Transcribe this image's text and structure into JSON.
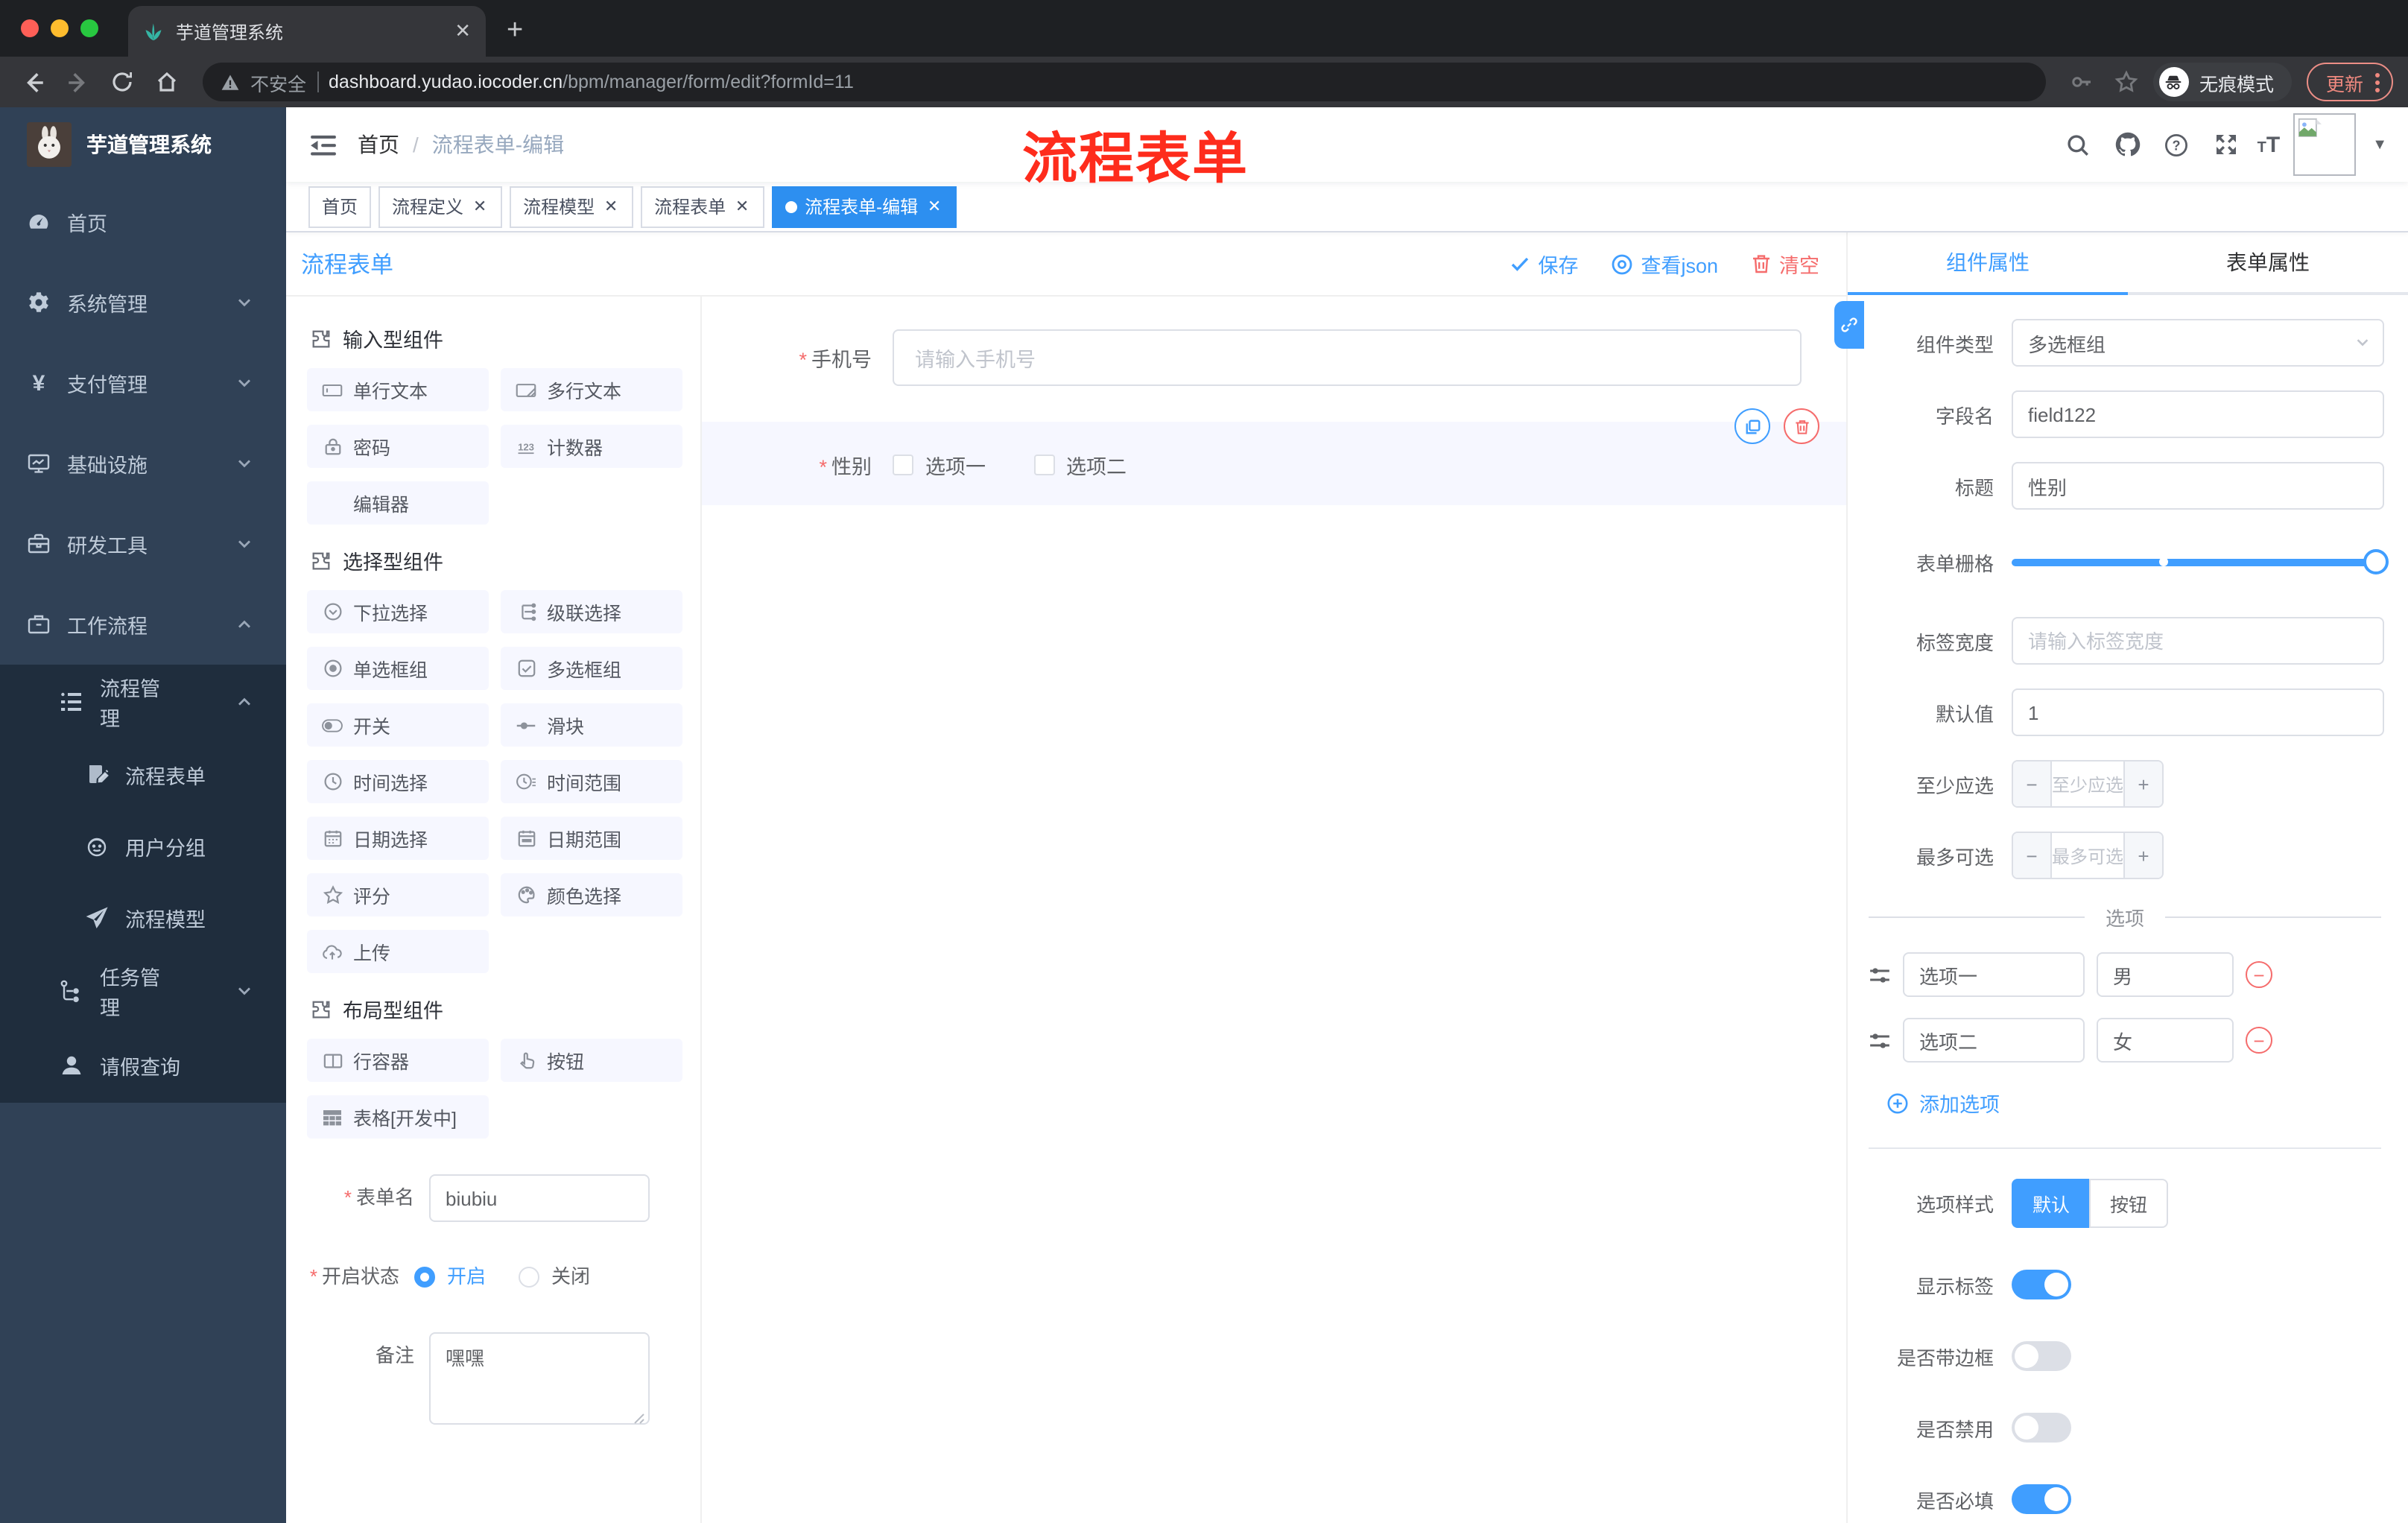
{
  "colors": {
    "accent": "#409eff",
    "danger": "#f56c6c",
    "tag_active": "#2d8ff0",
    "sidebar_bg": "#304156",
    "submenu_bg": "#1f2d3d",
    "chip_bg": "#f6f7ff"
  },
  "browser": {
    "tab_title": "芋道管理系统",
    "security_label": "不安全",
    "url_host": "dashboard.yudao.iocoder.cn",
    "url_path": "/bpm/manager/form/edit?formId=11",
    "incognito_label": "无痕模式",
    "update_label": "更新"
  },
  "annotation": {
    "text": "流程表单"
  },
  "sidebar": {
    "logo_title": "芋道管理系统",
    "items": [
      {
        "key": "home",
        "icon": "dashboard",
        "label": "首页",
        "arrow": ""
      },
      {
        "key": "system",
        "icon": "gear",
        "label": "系统管理",
        "arrow": "down"
      },
      {
        "key": "payment",
        "icon": "yen",
        "label": "支付管理",
        "arrow": "down"
      },
      {
        "key": "infra",
        "icon": "monitor",
        "label": "基础设施",
        "arrow": "down"
      },
      {
        "key": "devtools",
        "icon": "toolbox",
        "label": "研发工具",
        "arrow": "down"
      },
      {
        "key": "workflow",
        "icon": "briefcase",
        "label": "工作流程",
        "arrow": "up"
      }
    ],
    "submenu": [
      {
        "key": "process-mgmt",
        "icon": "listtree",
        "label": "流程管理",
        "arrow": "up",
        "level": 1
      },
      {
        "key": "process-form",
        "icon": "docedit",
        "label": "流程表单",
        "arrow": "",
        "level": 2
      },
      {
        "key": "user-group",
        "icon": "face",
        "label": "用户分组",
        "arrow": "",
        "level": 2
      },
      {
        "key": "process-model",
        "icon": "send",
        "label": "流程模型",
        "arrow": "",
        "level": 2
      },
      {
        "key": "task-mgmt",
        "icon": "tree",
        "label": "任务管理",
        "arrow": "down",
        "level": 1
      },
      {
        "key": "leave-query",
        "icon": "person",
        "label": "请假查询",
        "arrow": "",
        "level": 1
      }
    ]
  },
  "navbar": {
    "breadcrumb_home": "首页",
    "breadcrumb_sep": "/",
    "breadcrumb_current": "流程表单-编辑"
  },
  "tags": [
    {
      "key": "home",
      "label": "首页",
      "closable": false,
      "active": false
    },
    {
      "key": "process-def",
      "label": "流程定义",
      "closable": true,
      "active": false
    },
    {
      "key": "process-model",
      "label": "流程模型",
      "closable": true,
      "active": false
    },
    {
      "key": "process-form",
      "label": "流程表单",
      "closable": true,
      "active": false
    },
    {
      "key": "process-form-edit",
      "label": "流程表单-编辑",
      "closable": true,
      "active": true
    }
  ],
  "editor": {
    "title": "流程表单",
    "actions": {
      "save": "保存",
      "view_json": "查看json",
      "clear": "清空"
    },
    "palette": {
      "sections": [
        {
          "title": "输入型组件",
          "items": [
            {
              "icon": "input",
              "label": "单行文本"
            },
            {
              "icon": "textarea",
              "label": "多行文本"
            },
            {
              "icon": "lock",
              "label": "密码"
            },
            {
              "icon": "counter",
              "label": "计数器"
            },
            {
              "icon": "none",
              "label": "编辑器"
            }
          ]
        },
        {
          "title": "选择型组件",
          "items": [
            {
              "icon": "select",
              "label": "下拉选择"
            },
            {
              "icon": "cascader",
              "label": "级联选择"
            },
            {
              "icon": "radio",
              "label": "单选框组"
            },
            {
              "icon": "checkbox",
              "label": "多选框组"
            },
            {
              "icon": "switch",
              "label": "开关"
            },
            {
              "icon": "slideri",
              "label": "滑块"
            },
            {
              "icon": "time",
              "label": "时间选择"
            },
            {
              "icon": "timerange",
              "label": "时间范围"
            },
            {
              "icon": "date",
              "label": "日期选择"
            },
            {
              "icon": "daterange",
              "label": "日期范围"
            },
            {
              "icon": "star",
              "label": "评分"
            },
            {
              "icon": "palettei",
              "label": "颜色选择"
            },
            {
              "icon": "upload",
              "label": "上传"
            }
          ]
        },
        {
          "title": "布局型组件",
          "items": [
            {
              "icon": "rowc",
              "label": "行容器"
            },
            {
              "icon": "hand",
              "label": "按钮"
            },
            {
              "icon": "tablei",
              "label": "表格[开发中]"
            }
          ]
        }
      ]
    },
    "meta": {
      "name_label": "表单名",
      "name_value": "biubiu",
      "status_label": "开启状态",
      "status_on": "开启",
      "status_off": "关闭",
      "remark_label": "备注",
      "remark_value": "嘿嘿"
    },
    "canvas": {
      "phone": {
        "label": "手机号",
        "placeholder": "请输入手机号"
      },
      "gender": {
        "label": "性别",
        "options": [
          "选项一",
          "选项二"
        ]
      }
    }
  },
  "props": {
    "tabs": {
      "component": "组件属性",
      "form": "表单属性"
    },
    "rows": {
      "type_label": "组件类型",
      "type_value": "多选框组",
      "field_label": "字段名",
      "field_value": "field122",
      "title_label": "标题",
      "title_value": "性别",
      "grid_label": "表单栅格",
      "labelw_label": "标签宽度",
      "labelw_placeholder": "请输入标签宽度",
      "default_label": "默认值",
      "default_value": "1",
      "min_label": "至少应选",
      "min_placeholder": "至少应选",
      "max_label": "最多可选",
      "max_placeholder": "最多可选"
    },
    "options_title": "选项",
    "options": [
      {
        "label": "选项一",
        "value": "男"
      },
      {
        "label": "选项二",
        "value": "女"
      }
    ],
    "add_option_label": "添加选项",
    "style_label": "选项样式",
    "style_choices": [
      {
        "label": "默认",
        "on": true
      },
      {
        "label": "按钮",
        "on": false
      }
    ],
    "switches": [
      {
        "key": "show-label",
        "label": "显示标签",
        "on": true
      },
      {
        "key": "bordered",
        "label": "是否带边框",
        "on": false
      },
      {
        "key": "disabled",
        "label": "是否禁用",
        "on": false
      },
      {
        "key": "required",
        "label": "是否必填",
        "on": true
      }
    ]
  }
}
